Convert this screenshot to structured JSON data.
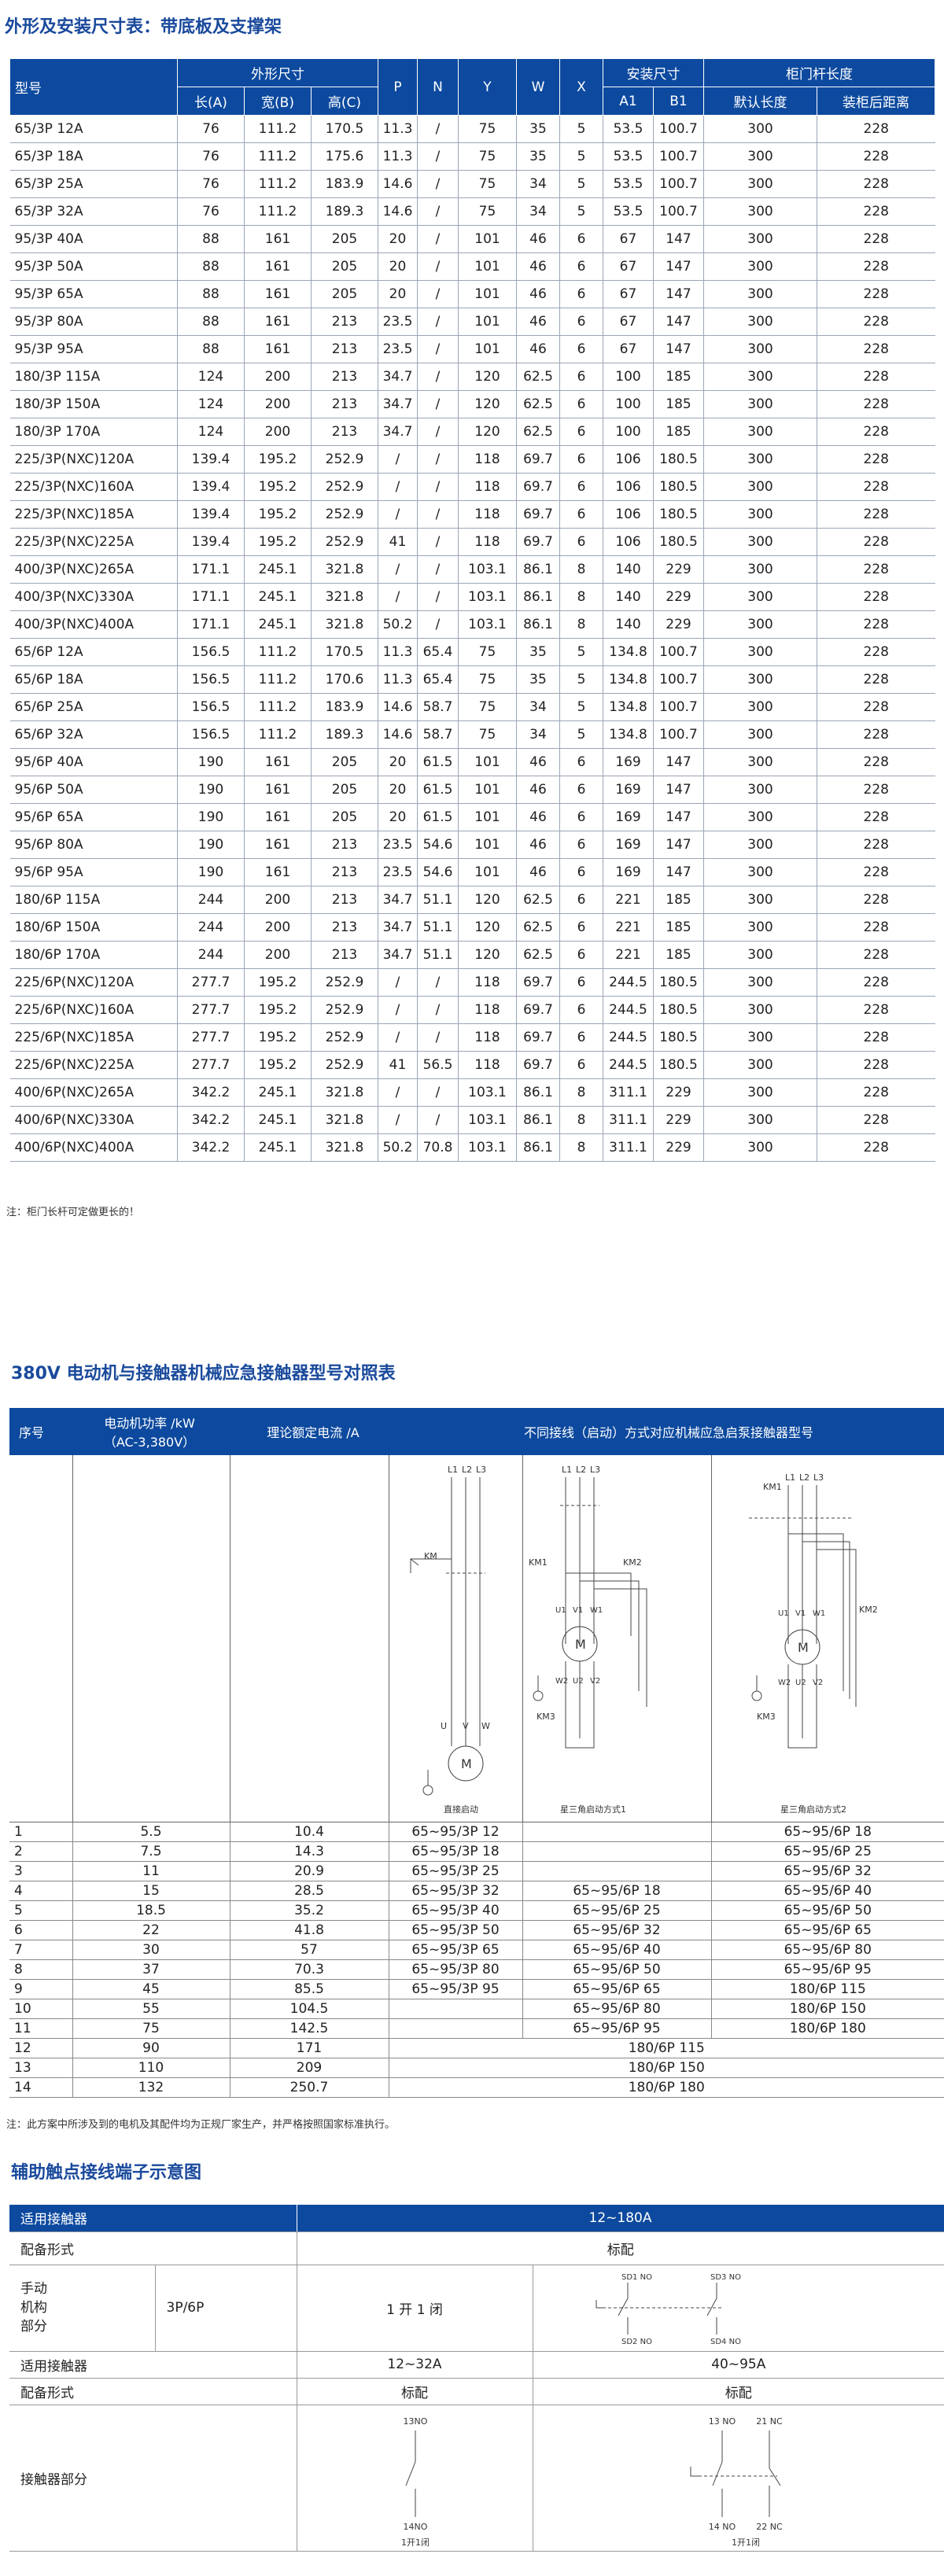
{
  "section1": {
    "title": "外形及安装尺寸表：带底板及支撑架",
    "headers": {
      "model": "型号",
      "dims": "外形尺寸",
      "P": "P",
      "N": "N",
      "Y": "Y",
      "W": "W",
      "X": "X",
      "install": "安装尺寸",
      "rod": "柜门杆长度",
      "A": "长(A)",
      "B": "宽(B)",
      "C": "高(C)",
      "A1": "A1",
      "B1": "B1",
      "default_len": "默认长度",
      "behind": "装柜后距离"
    },
    "rows": [
      [
        "65/3P 12A",
        "76",
        "111.2",
        "170.5",
        "11.3",
        "/",
        "75",
        "35",
        "5",
        "53.5",
        "100.7",
        "300",
        "228"
      ],
      [
        "65/3P 18A",
        "76",
        "111.2",
        "175.6",
        "11.3",
        "/",
        "75",
        "35",
        "5",
        "53.5",
        "100.7",
        "300",
        "228"
      ],
      [
        "65/3P 25A",
        "76",
        "111.2",
        "183.9",
        "14.6",
        "/",
        "75",
        "34",
        "5",
        "53.5",
        "100.7",
        "300",
        "228"
      ],
      [
        "65/3P 32A",
        "76",
        "111.2",
        "189.3",
        "14.6",
        "/",
        "75",
        "34",
        "5",
        "53.5",
        "100.7",
        "300",
        "228"
      ],
      [
        "95/3P 40A",
        "88",
        "161",
        "205",
        "20",
        "/",
        "101",
        "46",
        "6",
        "67",
        "147",
        "300",
        "228"
      ],
      [
        "95/3P 50A",
        "88",
        "161",
        "205",
        "20",
        "/",
        "101",
        "46",
        "6",
        "67",
        "147",
        "300",
        "228"
      ],
      [
        "95/3P 65A",
        "88",
        "161",
        "205",
        "20",
        "/",
        "101",
        "46",
        "6",
        "67",
        "147",
        "300",
        "228"
      ],
      [
        "95/3P 80A",
        "88",
        "161",
        "213",
        "23.5",
        "/",
        "101",
        "46",
        "6",
        "67",
        "147",
        "300",
        "228"
      ],
      [
        "95/3P 95A",
        "88",
        "161",
        "213",
        "23.5",
        "/",
        "101",
        "46",
        "6",
        "67",
        "147",
        "300",
        "228"
      ],
      [
        "180/3P 115A",
        "124",
        "200",
        "213",
        "34.7",
        "/",
        "120",
        "62.5",
        "6",
        "100",
        "185",
        "300",
        "228"
      ],
      [
        "180/3P 150A",
        "124",
        "200",
        "213",
        "34.7",
        "/",
        "120",
        "62.5",
        "6",
        "100",
        "185",
        "300",
        "228"
      ],
      [
        "180/3P 170A",
        "124",
        "200",
        "213",
        "34.7",
        "/",
        "120",
        "62.5",
        "6",
        "100",
        "185",
        "300",
        "228"
      ],
      [
        "225/3P(NXC)120A",
        "139.4",
        "195.2",
        "252.9",
        "/",
        "/",
        "118",
        "69.7",
        "6",
        "106",
        "180.5",
        "300",
        "228"
      ],
      [
        "225/3P(NXC)160A",
        "139.4",
        "195.2",
        "252.9",
        "/",
        "/",
        "118",
        "69.7",
        "6",
        "106",
        "180.5",
        "300",
        "228"
      ],
      [
        "225/3P(NXC)185A",
        "139.4",
        "195.2",
        "252.9",
        "/",
        "/",
        "118",
        "69.7",
        "6",
        "106",
        "180.5",
        "300",
        "228"
      ],
      [
        "225/3P(NXC)225A",
        "139.4",
        "195.2",
        "252.9",
        "41",
        "/",
        "118",
        "69.7",
        "6",
        "106",
        "180.5",
        "300",
        "228"
      ],
      [
        "400/3P(NXC)265A",
        "171.1",
        "245.1",
        "321.8",
        "/",
        "/",
        "103.1",
        "86.1",
        "8",
        "140",
        "229",
        "300",
        "228"
      ],
      [
        "400/3P(NXC)330A",
        "171.1",
        "245.1",
        "321.8",
        "/",
        "/",
        "103.1",
        "86.1",
        "8",
        "140",
        "229",
        "300",
        "228"
      ],
      [
        "400/3P(NXC)400A",
        "171.1",
        "245.1",
        "321.8",
        "50.2",
        "/",
        "103.1",
        "86.1",
        "8",
        "140",
        "229",
        "300",
        "228"
      ],
      [
        "65/6P 12A",
        "156.5",
        "111.2",
        "170.5",
        "11.3",
        "65.4",
        "75",
        "35",
        "5",
        "134.8",
        "100.7",
        "300",
        "228"
      ],
      [
        "65/6P 18A",
        "156.5",
        "111.2",
        "170.6",
        "11.3",
        "65.4",
        "75",
        "35",
        "5",
        "134.8",
        "100.7",
        "300",
        "228"
      ],
      [
        "65/6P 25A",
        "156.5",
        "111.2",
        "183.9",
        "14.6",
        "58.7",
        "75",
        "34",
        "5",
        "134.8",
        "100.7",
        "300",
        "228"
      ],
      [
        "65/6P 32A",
        "156.5",
        "111.2",
        "189.3",
        "14.6",
        "58.7",
        "75",
        "34",
        "5",
        "134.8",
        "100.7",
        "300",
        "228"
      ],
      [
        "95/6P 40A",
        "190",
        "161",
        "205",
        "20",
        "61.5",
        "101",
        "46",
        "6",
        "169",
        "147",
        "300",
        "228"
      ],
      [
        "95/6P 50A",
        "190",
        "161",
        "205",
        "20",
        "61.5",
        "101",
        "46",
        "6",
        "169",
        "147",
        "300",
        "228"
      ],
      [
        "95/6P 65A",
        "190",
        "161",
        "205",
        "20",
        "61.5",
        "101",
        "46",
        "6",
        "169",
        "147",
        "300",
        "228"
      ],
      [
        "95/6P 80A",
        "190",
        "161",
        "213",
        "23.5",
        "54.6",
        "101",
        "46",
        "6",
        "169",
        "147",
        "300",
        "228"
      ],
      [
        "95/6P 95A",
        "190",
        "161",
        "213",
        "23.5",
        "54.6",
        "101",
        "46",
        "6",
        "169",
        "147",
        "300",
        "228"
      ],
      [
        "180/6P 115A",
        "244",
        "200",
        "213",
        "34.7",
        "51.1",
        "120",
        "62.5",
        "6",
        "221",
        "185",
        "300",
        "228"
      ],
      [
        "180/6P 150A",
        "244",
        "200",
        "213",
        "34.7",
        "51.1",
        "120",
        "62.5",
        "6",
        "221",
        "185",
        "300",
        "228"
      ],
      [
        "180/6P 170A",
        "244",
        "200",
        "213",
        "34.7",
        "51.1",
        "120",
        "62.5",
        "6",
        "221",
        "185",
        "300",
        "228"
      ],
      [
        "225/6P(NXC)120A",
        "277.7",
        "195.2",
        "252.9",
        "/",
        "/",
        "118",
        "69.7",
        "6",
        "244.5",
        "180.5",
        "300",
        "228"
      ],
      [
        "225/6P(NXC)160A",
        "277.7",
        "195.2",
        "252.9",
        "/",
        "/",
        "118",
        "69.7",
        "6",
        "244.5",
        "180.5",
        "300",
        "228"
      ],
      [
        "225/6P(NXC)185A",
        "277.7",
        "195.2",
        "252.9",
        "/",
        "/",
        "118",
        "69.7",
        "6",
        "244.5",
        "180.5",
        "300",
        "228"
      ],
      [
        "225/6P(NXC)225A",
        "277.7",
        "195.2",
        "252.9",
        "41",
        "56.5",
        "118",
        "69.7",
        "6",
        "244.5",
        "180.5",
        "300",
        "228"
      ],
      [
        "400/6P(NXC)265A",
        "342.2",
        "245.1",
        "321.8",
        "/",
        "/",
        "103.1",
        "86.1",
        "8",
        "311.1",
        "229",
        "300",
        "228"
      ],
      [
        "400/6P(NXC)330A",
        "342.2",
        "245.1",
        "321.8",
        "/",
        "/",
        "103.1",
        "86.1",
        "8",
        "311.1",
        "229",
        "300",
        "228"
      ],
      [
        "400/6P(NXC)400A",
        "342.2",
        "245.1",
        "321.8",
        "50.2",
        "70.8",
        "103.1",
        "86.1",
        "8",
        "311.1",
        "229",
        "300",
        "228"
      ]
    ],
    "note": "注：柜门长杆可定做更长的！"
  },
  "section2": {
    "title": "380V 电动机与接触器机械应急接触器型号对照表",
    "headers": {
      "no": "序号",
      "power_l1": "电动机功率 /kW",
      "power_l2": "（AC-3,380V）",
      "current": "理论额定电流 /A",
      "models": "不同接线（启动）方式对应机械应急启泵接触器型号"
    },
    "diagram_labels": {
      "direct": "直接启动",
      "star1": "星三角启动方式1",
      "star2": "星三角启动方式2",
      "L1": "L1",
      "L2": "L2",
      "L3": "L3",
      "KM": "KM",
      "KM1": "KM1",
      "KM2": "KM2",
      "KM3": "KM3",
      "M": "M",
      "U": "U",
      "V": "V",
      "W": "W",
      "U1": "U1",
      "V1": "V1",
      "W1": "W1",
      "U2": "U2",
      "V2": "V2",
      "W2": "W2"
    },
    "rows": [
      [
        "1",
        "5.5",
        "10.4",
        "65~95/3P 12",
        "",
        "65~95/6P 18"
      ],
      [
        "2",
        "7.5",
        "14.3",
        "65~95/3P 18",
        "",
        "65~95/6P 25"
      ],
      [
        "3",
        "11",
        "20.9",
        "65~95/3P 25",
        "",
        "65~95/6P 32"
      ],
      [
        "4",
        "15",
        "28.5",
        "65~95/3P 32",
        "65~95/6P 18",
        "65~95/6P 40"
      ],
      [
        "5",
        "18.5",
        "35.2",
        "65~95/3P 40",
        "65~95/6P 25",
        "65~95/6P 50"
      ],
      [
        "6",
        "22",
        "41.8",
        "65~95/3P 50",
        "65~95/6P 32",
        "65~95/6P 65"
      ],
      [
        "7",
        "30",
        "57",
        "65~95/3P 65",
        "65~95/6P 40",
        "65~95/6P 80"
      ],
      [
        "8",
        "37",
        "70.3",
        "65~95/3P 80",
        "65~95/6P 50",
        "65~95/6P 95"
      ],
      [
        "9",
        "45",
        "85.5",
        "65~95/3P 95",
        "65~95/6P 65",
        "180/6P 115"
      ],
      [
        "10",
        "55",
        "104.5",
        "",
        "65~95/6P 80",
        "180/6P 150"
      ],
      [
        "11",
        "75",
        "142.5",
        "",
        "65~95/6P 95",
        "180/6P 180"
      ]
    ],
    "merged_rows": [
      [
        "12",
        "90",
        "171",
        "180/6P 115"
      ],
      [
        "13",
        "110",
        "209",
        "180/6P 150"
      ],
      [
        "14",
        "132",
        "250.7",
        "180/6P 180"
      ]
    ],
    "note": "注：此方案中所涉及到的电机及其配件均为正规厂家生产，并严格按照国家标准执行。"
  },
  "section3": {
    "title": "辅助触点接线端子示意图",
    "row1_label": "适用接触器",
    "row1_value": "12~180A",
    "row2_label": "配备形式",
    "row2_value": "标配",
    "row3_label_lines": [
      "手动",
      "机构",
      "部分"
    ],
    "row3_poles": "3P/6P",
    "row3_contact": "1 开 1 闭",
    "sd_labels": {
      "sd1": "SD1 NO",
      "sd3": "SD3 NO",
      "sd2": "SD2 NO",
      "sd4": "SD4 NO"
    },
    "row4_label": "适用接触器",
    "row4_a": "12~32A",
    "row4_b": "40~95A",
    "row5_label": "配备形式",
    "row5_a": "标配",
    "row5_b": "标配",
    "row6_label": "接触器部分",
    "contact_a": {
      "top": "13NO",
      "bottom": "14NO",
      "caption": "1开1闭"
    },
    "contact_b": {
      "top1": "13 NO",
      "top2": "21 NC",
      "bottom1": "14 NO",
      "bottom2": "22 NC",
      "caption": "1开1闭"
    }
  }
}
